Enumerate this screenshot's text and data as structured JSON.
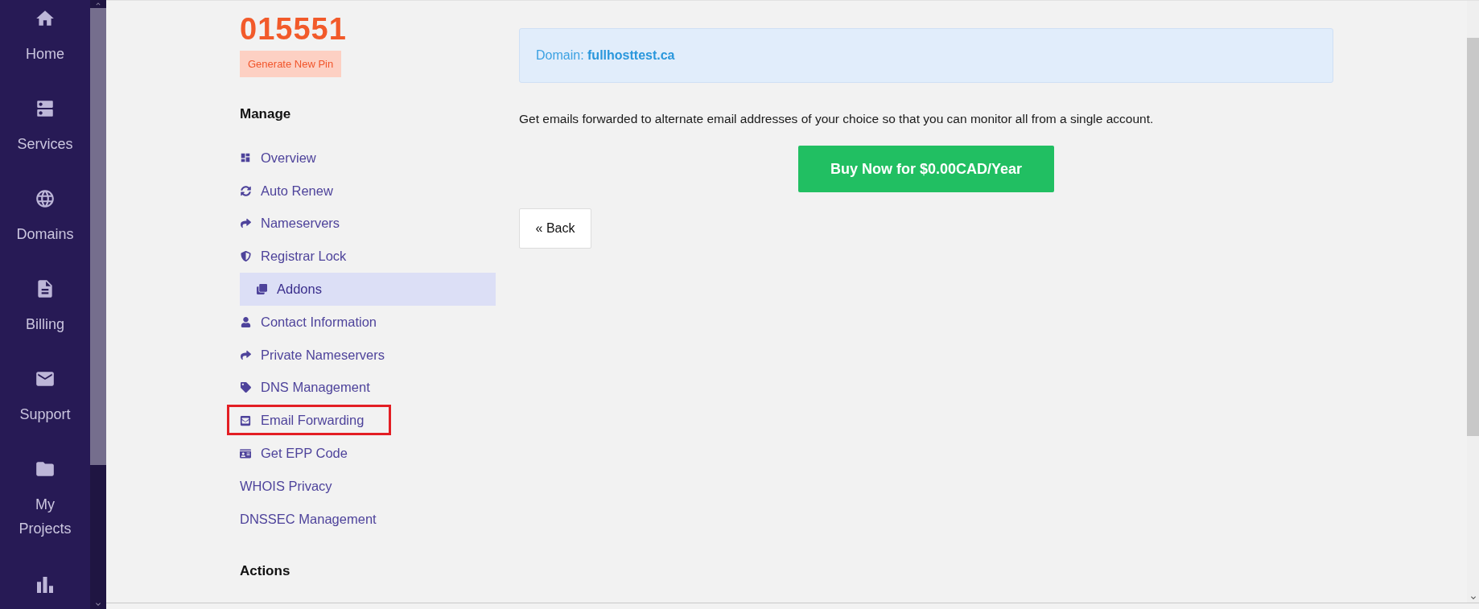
{
  "nav": {
    "items": [
      {
        "label": "Home"
      },
      {
        "label": "Services"
      },
      {
        "label": "Domains"
      },
      {
        "label": "Billing"
      },
      {
        "label": "Support"
      },
      {
        "label": "My Projects"
      }
    ]
  },
  "sidebar": {
    "pin": "015551",
    "pin_button": "Generate New Pin",
    "heading": "Manage",
    "items": [
      {
        "label": "Overview",
        "kind": "icon",
        "selected": false,
        "highlighted": false
      },
      {
        "label": "Auto Renew",
        "kind": "icon",
        "selected": false,
        "highlighted": false
      },
      {
        "label": "Nameservers",
        "kind": "icon",
        "selected": false,
        "highlighted": false
      },
      {
        "label": "Registrar Lock",
        "kind": "icon",
        "selected": false,
        "highlighted": false
      },
      {
        "label": "Addons",
        "kind": "icon",
        "selected": true,
        "highlighted": false
      },
      {
        "label": "Contact Information",
        "kind": "icon",
        "selected": false,
        "highlighted": false
      },
      {
        "label": "Private Nameservers",
        "kind": "icon",
        "selected": false,
        "highlighted": false
      },
      {
        "label": "DNS Management",
        "kind": "icon",
        "selected": false,
        "highlighted": false
      },
      {
        "label": "Email Forwarding",
        "kind": "icon",
        "selected": false,
        "highlighted": true
      },
      {
        "label": "Get EPP Code",
        "kind": "icon",
        "selected": false,
        "highlighted": false
      },
      {
        "label": "WHOIS Privacy",
        "kind": "plain",
        "selected": false,
        "highlighted": false
      },
      {
        "label": "DNSSEC Management",
        "kind": "plain",
        "selected": false,
        "highlighted": false
      }
    ],
    "actions_heading": "Actions"
  },
  "main": {
    "domain": "Domain: **fullhosttest.ca**",
    "description": "Get emails forwarded to alternate email addresses of your choice so that you can monitor all from a single account.",
    "buy_button": "Buy Now for $0.00CAD/Year",
    "back_button": "« Back"
  }
}
